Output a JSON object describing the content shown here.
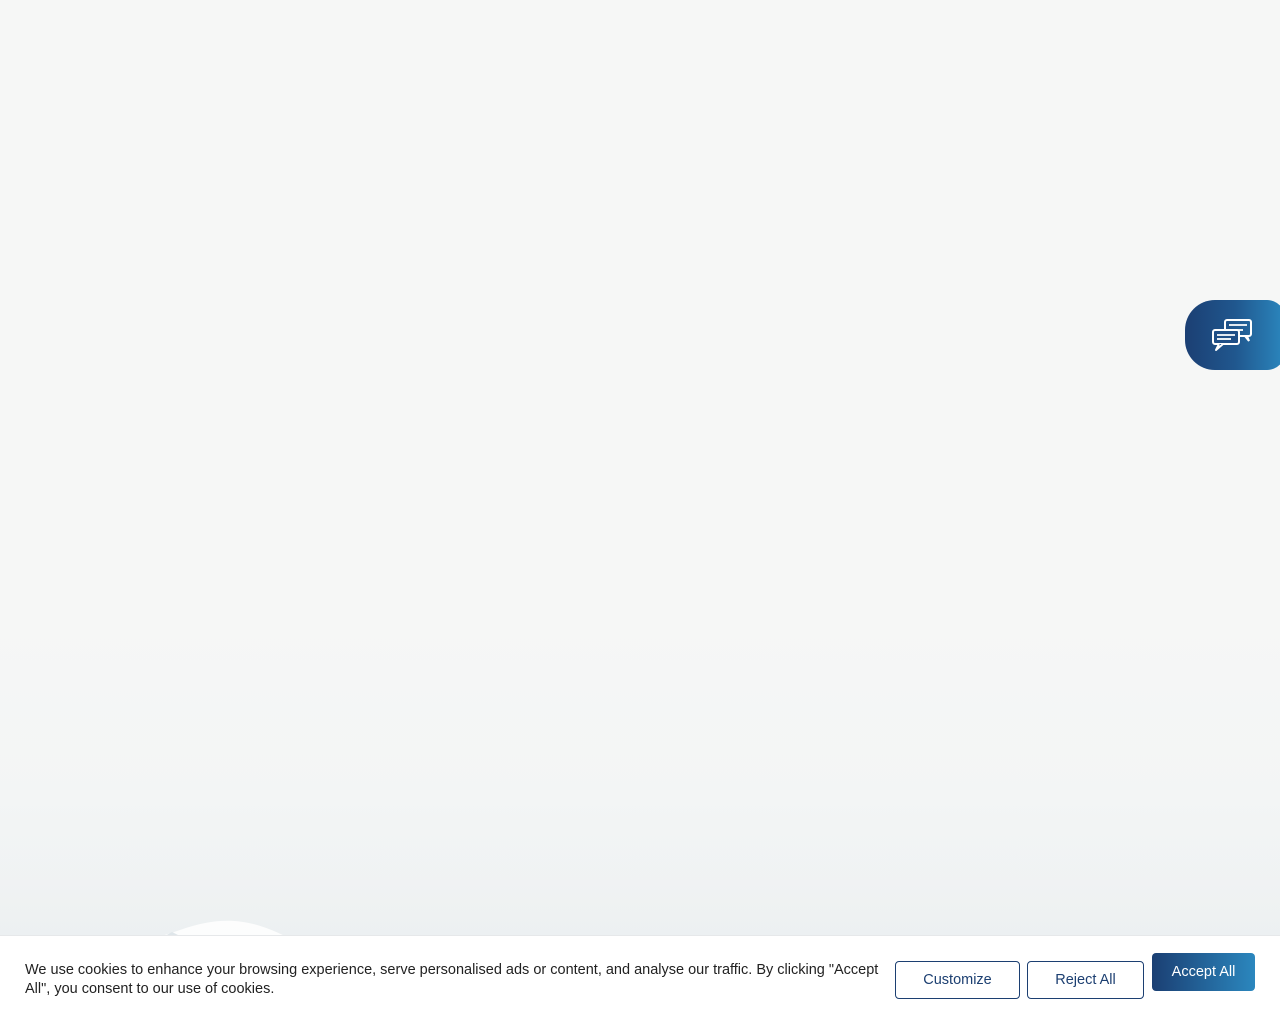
{
  "chat_widget": {
    "icon": "chat-bubbles-icon",
    "colors": {
      "from": "#1b3f73",
      "to": "#2b87be"
    }
  },
  "cookie_banner": {
    "message": "We use cookies to enhance your browsing experience, serve personalised ads or content, and analyse our traffic. By clicking \"Accept All\", you consent to our use of cookies.",
    "customize_label": "Customize",
    "reject_label": "Reject All",
    "accept_label": "Accept All",
    "accent_color": "#1c3f71"
  }
}
